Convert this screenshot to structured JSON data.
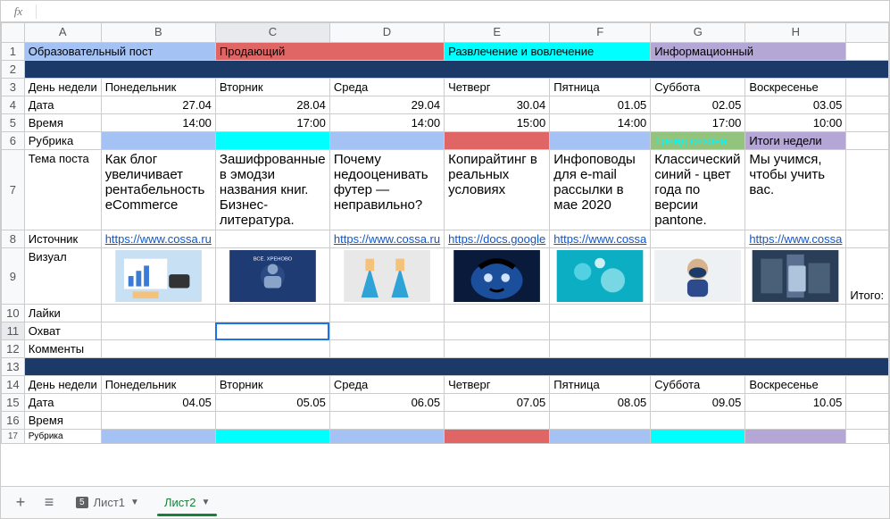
{
  "fx": {
    "label": "fx",
    "value": ""
  },
  "columns": [
    "A",
    "B",
    "C",
    "D",
    "E",
    "F",
    "G",
    "H"
  ],
  "colors": {
    "edu": "#a4c2f4",
    "sell": "#e06666",
    "fun": "#00ffff",
    "info": "#b4a7d6",
    "darkrow": "#1c3a67",
    "trend_bg": "#6aa84f",
    "trend_bg2": "#93c47d",
    "trend_txt": "#00ffff"
  },
  "legend": {
    "edu": "Образовательный пост",
    "sell": "Продающий",
    "fun": "Развлечение и вовлечение",
    "info": "Информационный"
  },
  "labels": {
    "day": "День недели",
    "date": "Дата",
    "time": "Время",
    "rubric": "Рубрика",
    "topic": "Тема поста",
    "source": "Источник",
    "visual": "Визуал",
    "likes": "Лайки",
    "reach": "Охват",
    "comments": "Комменты",
    "total": "Итого:"
  },
  "week1": {
    "days": [
      "Понедельник",
      "Вторник",
      "Среда",
      "Четверг",
      "Пятница",
      "Суббота",
      "Воскресенье"
    ],
    "dates": [
      "27.04",
      "28.04",
      "29.04",
      "30.04",
      "01.05",
      "02.05",
      "03.05"
    ],
    "times": [
      "14:00",
      "17:00",
      "14:00",
      "15:00",
      "14:00",
      "17:00",
      "10:00"
    ],
    "rubric_g": "Тренд сезона",
    "rubric_h": "Итоги недели",
    "topics": [
      "Как блог увеличивает рентабельность eCommerce",
      "Зашифрованные в эмодзи названия книг. Бизнес-литература.",
      "Почему недооценивать футер — неправильно?",
      "Копирайтинг в реальных условиях",
      "Инфоповоды для e-mail рассылки в мае 2020",
      "Классический синий - цвет года по версии pantone.",
      "Мы учимся, чтобы учить вас."
    ],
    "sources": {
      "b": "https://www.cossa.ru",
      "d": "https://www.cossa.ru",
      "e": "https://docs.google",
      "f": "https://www.cossa",
      "h": "https://www.cossa"
    }
  },
  "week2": {
    "days": [
      "Понедельник",
      "Вторник",
      "Среда",
      "Четверг",
      "Пятница",
      "Суббота",
      "Воскресенье"
    ],
    "dates": [
      "04.05",
      "05.05",
      "06.05",
      "07.05",
      "08.05",
      "09.05",
      "10.05"
    ]
  },
  "tabs": {
    "add": "+",
    "all": "≡",
    "sheet1_badge": "5",
    "sheet1": "Лист1",
    "sheet2": "Лист2"
  }
}
